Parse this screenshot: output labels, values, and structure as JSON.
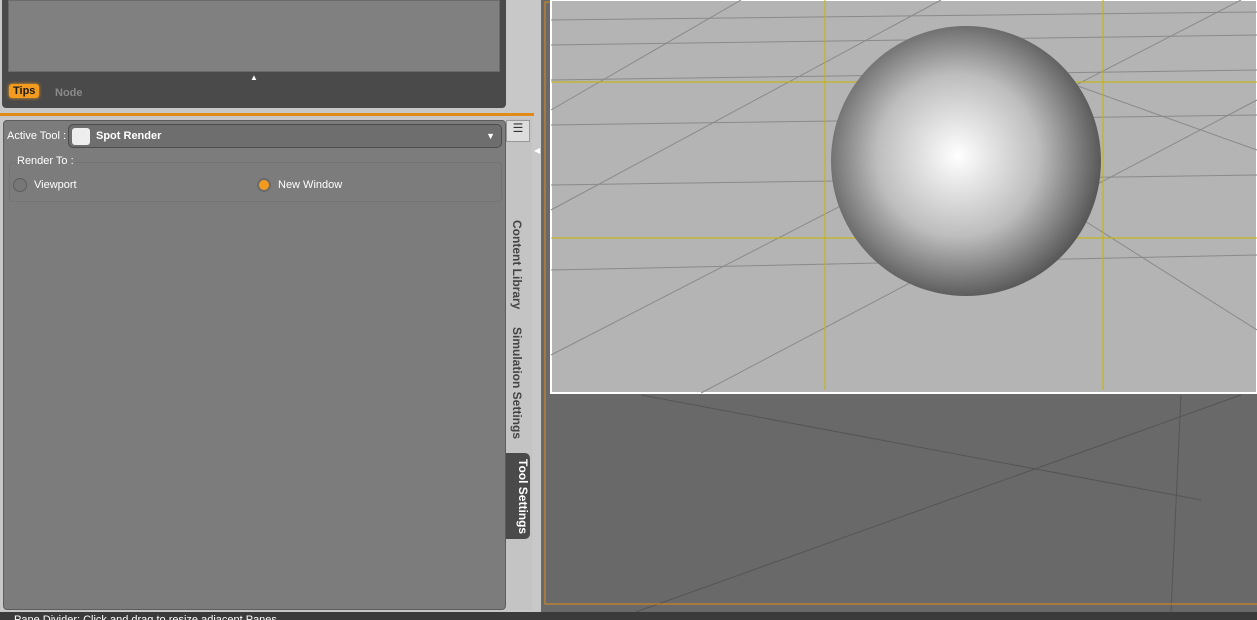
{
  "top_pane": {
    "tabs": [
      {
        "label": "Tips",
        "active": true
      },
      {
        "label": "Node",
        "active": false
      }
    ]
  },
  "tool_settings": {
    "active_tool_label": "Active Tool :",
    "active_tool_value": "Spot Render",
    "render_to_label": "Render To :",
    "options": [
      {
        "label": "Viewport",
        "selected": false
      },
      {
        "label": "New Window",
        "selected": true
      }
    ]
  },
  "side_tabs": [
    "Content Library",
    "Simulation Settings",
    "Tool Settings"
  ],
  "status_bar": "Pane Divider: Click and drag to resize adjacent Panes",
  "colors": {
    "accent": "#f39b1e",
    "guide": "#c8b400"
  }
}
